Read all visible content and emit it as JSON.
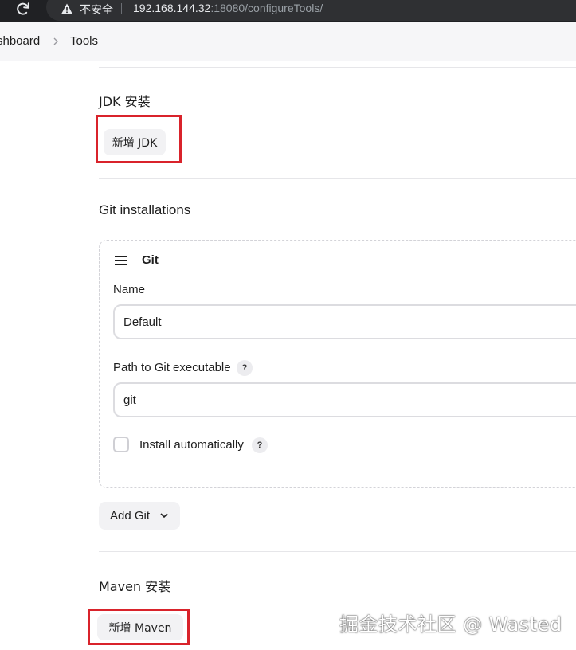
{
  "browser": {
    "insecure_label": "不安全",
    "url_host": "192.168.144.32",
    "url_rest": ":18080/configureTools/"
  },
  "breadcrumb": {
    "items": [
      {
        "label": "shboard"
      },
      {
        "label": "Tools"
      }
    ]
  },
  "jdk": {
    "title": "JDK 安装",
    "add_button": "新增 JDK"
  },
  "git": {
    "title": "Git installations",
    "card_title": "Git",
    "name_label": "Name",
    "name_value": "Default",
    "path_label": "Path to Git executable",
    "path_value": "git",
    "help_glyph": "?",
    "install_auto_label": "Install automatically",
    "add_button": "Add Git"
  },
  "maven": {
    "title": "Maven 安装",
    "add_button": "新增 Maven"
  },
  "watermark": "掘金技术社区 @ Wasted",
  "colors": {
    "highlight": "#d9232b",
    "topbar": "#202124",
    "button_bg": "#f2f2f4"
  }
}
